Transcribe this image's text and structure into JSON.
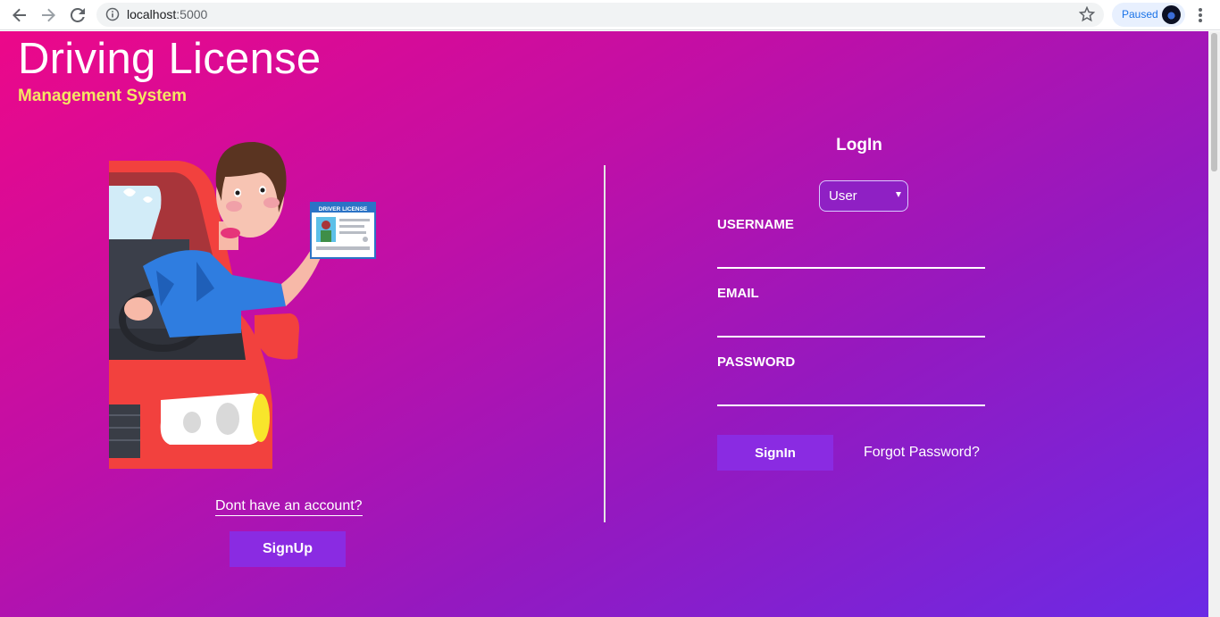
{
  "browser": {
    "url_host": "localhost",
    "url_port": ":5000",
    "profile_status": "Paused",
    "icons": [
      "back-arrow-icon",
      "forward-arrow-icon",
      "reload-icon",
      "info-icon",
      "star-icon",
      "menu-dots-icon"
    ]
  },
  "header": {
    "title": "Driving License",
    "subtitle": "Management System"
  },
  "left": {
    "account_prompt": "Dont have an account?",
    "signup_label": "SignUp"
  },
  "login": {
    "title": "LogIn",
    "role_selected": "User",
    "username_label": "USERNAME",
    "email_label": "EMAIL",
    "password_label": "PASSWORD",
    "signin_label": "SignIn",
    "forgot_label": "Forgot Password?"
  },
  "illustration": {
    "card_title": "DRIVER LICENSE"
  },
  "colors": {
    "gradient_start": "#ec0889",
    "gradient_end": "#6b2ae5",
    "button": "#8a2be2",
    "subtitle": "#f5e663"
  }
}
